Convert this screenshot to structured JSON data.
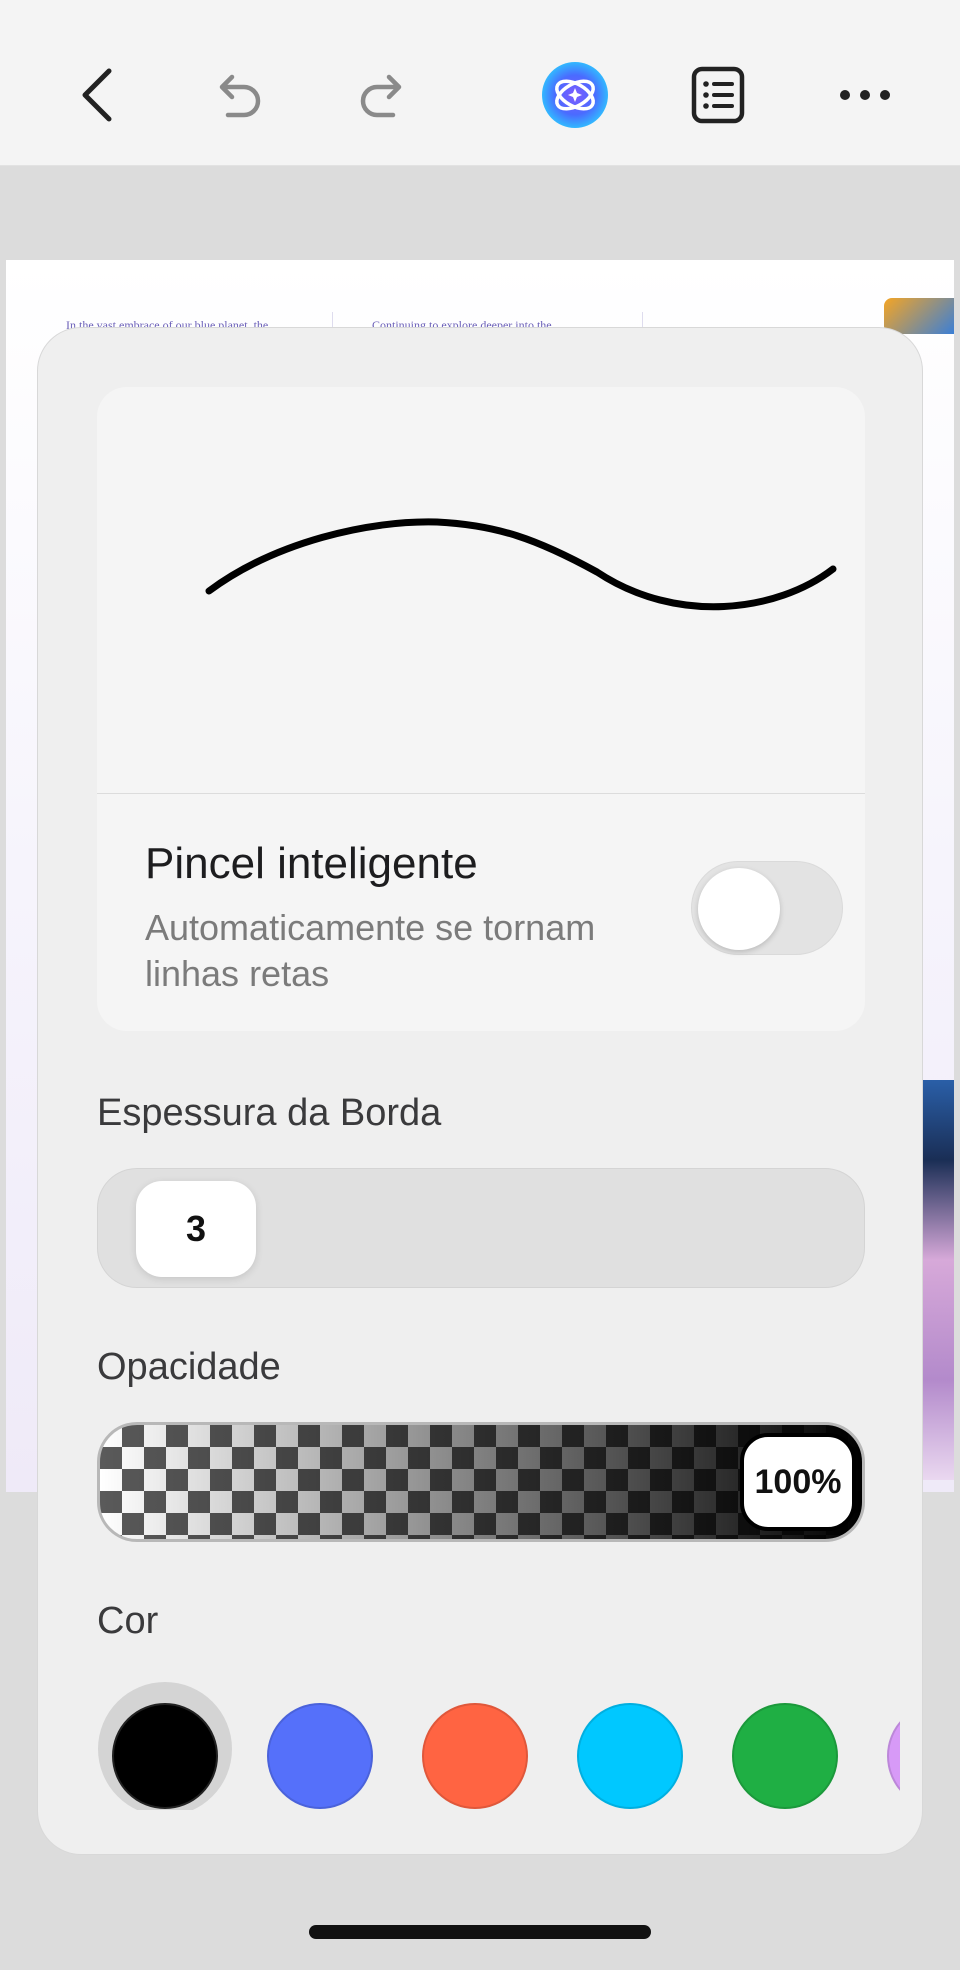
{
  "toolbar": {
    "icons": [
      "back-icon",
      "undo-icon",
      "redo-icon",
      "ai-assistant-icon",
      "outline-list-icon",
      "more-icon"
    ]
  },
  "document": {
    "col1_text": "In the vast embrace of our blue planet, the",
    "col2_text": "Continuing to explore deeper into the"
  },
  "panel": {
    "smart_brush": {
      "title": "Pincel inteligente",
      "description": "Automaticamente se tornam linhas retas",
      "enabled": false
    },
    "thickness": {
      "label": "Espessura da Borda",
      "value": "3"
    },
    "opacity": {
      "label": "Opacidade",
      "value": "100%"
    },
    "color": {
      "label": "Cor",
      "swatches": [
        "#000000",
        "#5570fa",
        "#ff6442",
        "#00c8ff",
        "#1faf44",
        "#d79af7"
      ],
      "selected": "#000000"
    }
  }
}
